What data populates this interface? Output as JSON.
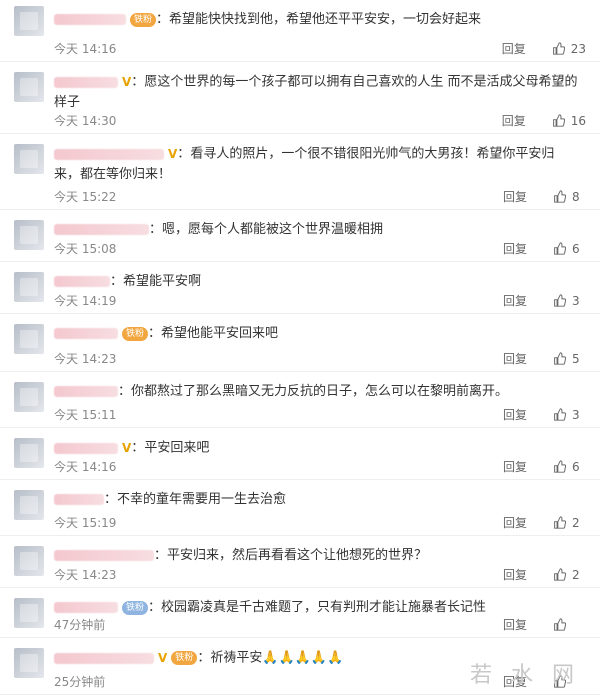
{
  "comments": [
    {
      "text": "希望能快快找到他，希望他还平平安安，一切会好起来",
      "time": "今天 14:16",
      "reply": "回复",
      "likes": "23",
      "badge": "fan",
      "vip": false,
      "name_w": 72
    },
    {
      "text": "愿这个世界的每一个孩子都可以拥有自己喜欢的人生 而不是活成父母希望的样子",
      "time": "今天 14:30",
      "reply": "回复",
      "likes": "16",
      "badge": "none",
      "vip": true,
      "name_w": 64
    },
    {
      "text": "看寻人的照片，一个很不错很阳光帅气的大男孩！希望你平安归来，都在等你归来！",
      "time": "今天 15:22",
      "reply": "回复",
      "likes": "8",
      "badge": "none",
      "vip": true,
      "name_w": 110
    },
    {
      "text": "嗯，愿每个人都能被这个世界温暖相拥",
      "time": "今天 15:08",
      "reply": "回复",
      "likes": "6",
      "badge": "none",
      "vip": false,
      "name_w": 95
    },
    {
      "text": "希望能平安啊",
      "time": "今天 14:19",
      "reply": "回复",
      "likes": "3",
      "badge": "none",
      "vip": false,
      "name_w": 56
    },
    {
      "text": "希望他能平安回来吧",
      "time": "今天 14:23",
      "reply": "回复",
      "likes": "5",
      "badge": "fan",
      "vip": false,
      "name_w": 64
    },
    {
      "text": "你都熬过了那么黑暗又无力反抗的日子，怎么可以在黎明前离开。",
      "time": "今天 15:11",
      "reply": "回复",
      "likes": "3",
      "badge": "none",
      "vip": false,
      "name_w": 64
    },
    {
      "text": "平安回来吧",
      "time": "今天 14:16",
      "reply": "回复",
      "likes": "6",
      "badge": "none",
      "vip": true,
      "name_w": 64
    },
    {
      "text": "不幸的童年需要用一生去治愈",
      "time": "今天 15:19",
      "reply": "回复",
      "likes": "2",
      "badge": "none",
      "vip": false,
      "name_w": 50
    },
    {
      "text": "平安归来，然后再看看这个让他想死的世界？",
      "time": "今天 14:23",
      "reply": "回复",
      "likes": "2",
      "badge": "none",
      "vip": false,
      "name_w": 100
    },
    {
      "text": "校园霸凌真是千古难题了，只有判刑才能让施暴者长记性",
      "time": "47分钟前",
      "reply": "回复",
      "likes": "",
      "badge": "fan_blue",
      "vip": false,
      "name_w": 64
    },
    {
      "text": "祈祷平安🙏🙏🙏🙏🙏",
      "time": "25分钟前",
      "reply": "回复",
      "likes": "",
      "badge": "fan",
      "vip": true,
      "name_w": 100
    }
  ],
  "badges": {
    "fan_label": "铁粉",
    "vip_mark": "V"
  },
  "watermark": "若 水 网",
  "colors": {
    "name_blur": "#f4c8cf",
    "fan_badge": "#f2a640",
    "fan_badge_blue": "#8fb4e0",
    "vip": "#e8a200"
  }
}
